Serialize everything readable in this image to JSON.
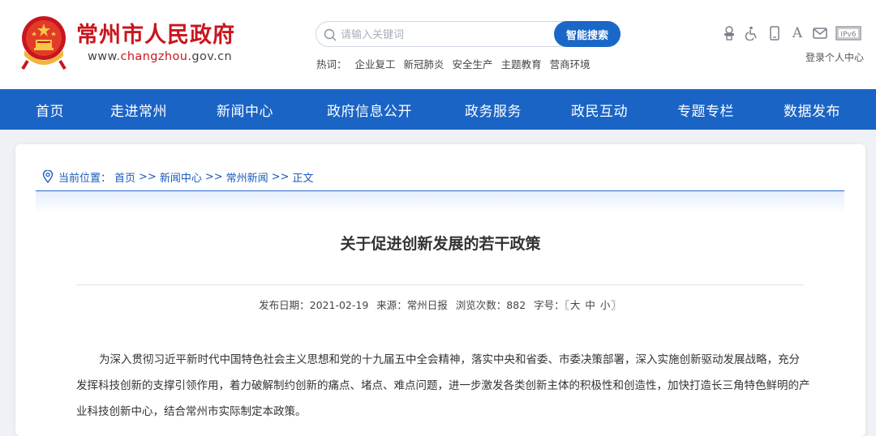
{
  "header": {
    "site_name": "常州市人民政府",
    "site_url_prefix": "www.",
    "site_url_highlight": "changzhou",
    "site_url_suffix": ".gov.cn",
    "search": {
      "placeholder": "请输入关键词",
      "button_label": "智能搜索"
    },
    "hot": {
      "label": "热词：",
      "words": [
        "企业复工",
        "新冠肺炎",
        "安全生产",
        "主题教育",
        "营商环境"
      ]
    },
    "tool_icons": [
      "elder-care-icon",
      "accessibility-icon",
      "mobile-icon",
      "font-size-icon",
      "mail-icon",
      "ipv6-icon"
    ],
    "font_letter": "A",
    "ipv6_label": "IPv6",
    "login_label": "登录个人中心"
  },
  "nav": {
    "items": [
      "首页",
      "走进常州",
      "新闻中心",
      "政府信息公开",
      "政务服务",
      "政民互动",
      "专题专栏",
      "数据发布"
    ]
  },
  "breadcrumb": {
    "label": "当前位置：",
    "crumbs": [
      "首页",
      ">>",
      "新闻中心",
      ">>",
      "常州新闻",
      ">>",
      "正文"
    ]
  },
  "article": {
    "title": "关于促进创新发展的若干政策",
    "meta": {
      "date": "发布日期：2021-02-19",
      "source": "来源：常州日报",
      "views": "浏览次数：882",
      "font_label": "字号：",
      "font_sizes": "〖大 中 小〗"
    },
    "paragraph": "为深入贯彻习近平新时代中国特色社会主义思想和党的十九届五中全会精神，落实中央和省委、市委决策部署，深入实施创新驱动发展战略，充分发挥科技创新的支撑引领作用，着力破解制约创新的痛点、堵点、难点问题，进一步激发各类创新主体的积极性和创造性，加快打造长三角特色鲜明的产业科技创新中心，结合常州市实际制定本政策。"
  },
  "colors": {
    "brand_red": "#c8161d",
    "nav_blue": "#1a64c5",
    "link_blue": "#1b5bb8",
    "search_button": "#1b67c7"
  }
}
